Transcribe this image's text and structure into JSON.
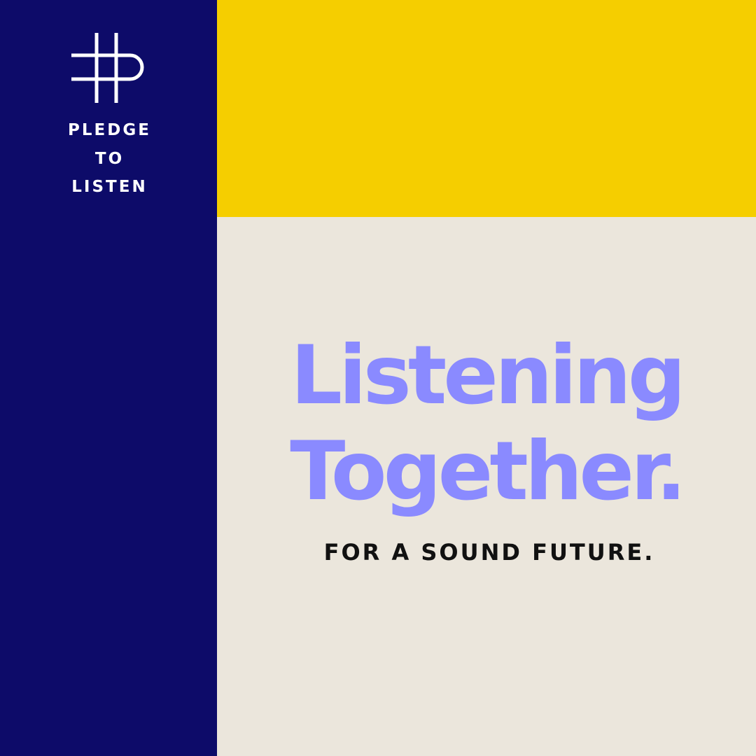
{
  "brand": {
    "logo_icon": "hash-p-monogram-icon",
    "name_lines": [
      "PLEDGE",
      "TO",
      "LISTEN"
    ]
  },
  "headline": {
    "line1": "Listening",
    "line2": "Together."
  },
  "tagline": "FOR A SOUND FUTURE.",
  "colors": {
    "sidebar": "#0d0b69",
    "top_block": "#f5ce00",
    "main_block": "#ebe6dc",
    "headline": "#8a8aff",
    "tagline": "#111111",
    "logo": "#ffffff"
  }
}
